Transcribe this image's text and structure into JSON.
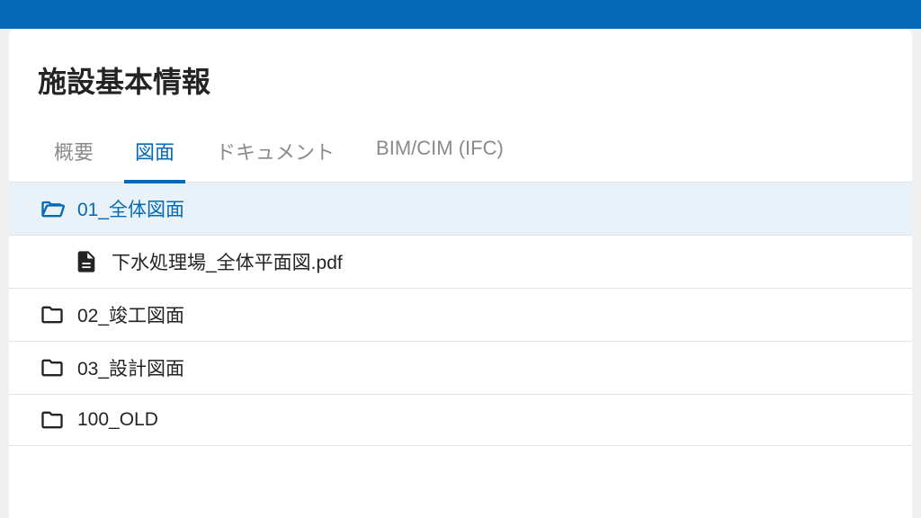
{
  "header": {
    "title": "施設基本情報"
  },
  "tabs": [
    {
      "label": "概要",
      "active": false
    },
    {
      "label": "図面",
      "active": true
    },
    {
      "label": "ドキュメント",
      "active": false
    },
    {
      "label": "BIM/CIM (IFC)",
      "active": false
    }
  ],
  "tree": {
    "folders": [
      {
        "name": "01_全体図面",
        "open": true,
        "selected": true,
        "files": [
          {
            "name": "下水処理場_全体平面図.pdf"
          }
        ]
      },
      {
        "name": "02_竣工図面",
        "open": false,
        "selected": false,
        "files": []
      },
      {
        "name": "03_設計図面",
        "open": false,
        "selected": false,
        "files": []
      },
      {
        "name": "100_OLD",
        "open": false,
        "selected": false,
        "files": []
      }
    ]
  }
}
